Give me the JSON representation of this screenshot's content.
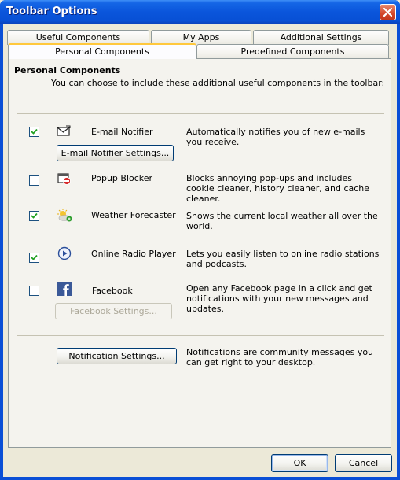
{
  "window": {
    "title": "Toolbar Options",
    "close_label": "×"
  },
  "tabs": {
    "row1": [
      "Useful Components",
      "My Apps",
      "Additional Settings"
    ],
    "row2": [
      "Personal Components",
      "Predefined Components"
    ],
    "active": "Personal Components"
  },
  "section": {
    "heading": "Personal Components",
    "subtitle": "You can choose to include these additional useful components in the toolbar:"
  },
  "components": [
    {
      "name": "E-mail Notifier",
      "checked": true,
      "icon": "envelope-icon",
      "description": "Automatically notifies you of new e-mails you receive.",
      "settings_button": "E-mail Notifier Settings...",
      "settings_enabled": true
    },
    {
      "name": "Popup Blocker",
      "checked": false,
      "icon": "popup-blocker-icon",
      "description": "Blocks annoying pop-ups and includes cookie cleaner, history cleaner, and cache cleaner."
    },
    {
      "name": "Weather Forecaster",
      "checked": true,
      "icon": "weather-icon",
      "description": "Shows the current local weather all over the world."
    },
    {
      "name": "Online Radio Player",
      "checked": true,
      "icon": "play-icon",
      "description": "Lets you easily listen to online radio stations and podcasts."
    },
    {
      "name": "Facebook",
      "checked": false,
      "icon": "facebook-icon",
      "description": "Open any Facebook page in a click and get notifications with your new messages and updates.",
      "settings_button": "Facebook Settings...",
      "settings_enabled": false
    }
  ],
  "notification": {
    "button": "Notification Settings...",
    "description": "Notifications are community messages you can get right to your desktop."
  },
  "footer": {
    "ok_label": "OK",
    "cancel_label": "Cancel"
  },
  "colors": {
    "titlebar": "#0a55db",
    "dialog_bg": "#ece9d8",
    "panel_bg": "#f4f3ee",
    "active_tab_accent": "#ffc83c",
    "close_button": "#d3472a"
  }
}
